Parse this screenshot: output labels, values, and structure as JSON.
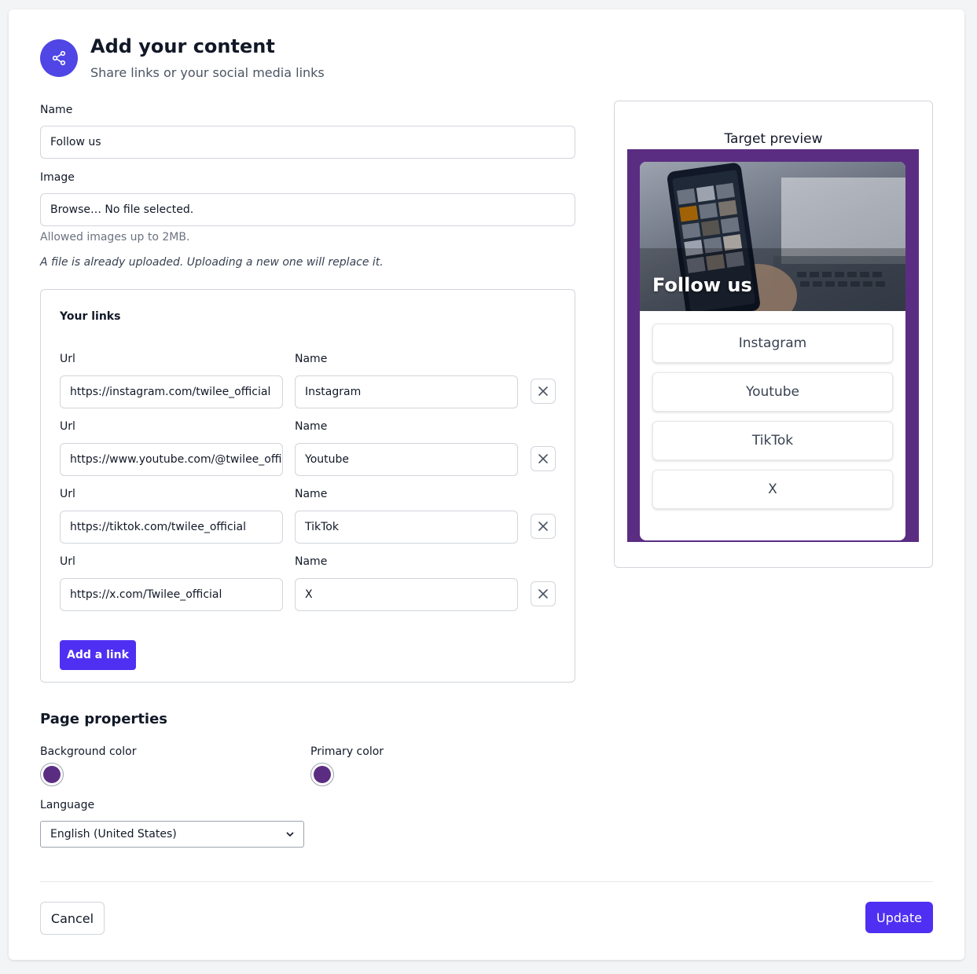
{
  "header": {
    "title": "Add your content",
    "subtitle": "Share links or your social media links",
    "icon": "share-icon"
  },
  "form": {
    "name_label": "Name",
    "name_value": "Follow us",
    "image_label": "Image",
    "image_value": "Browse… No file selected.",
    "image_hint": "Allowed images up to 2MB.",
    "image_notice": "A file is already uploaded. Uploading a new one will replace it."
  },
  "links": {
    "title": "Your links",
    "url_label": "Url",
    "name_label": "Name",
    "items": [
      {
        "url": "https://instagram.com/twilee_official",
        "name": "Instagram"
      },
      {
        "url": "https://www.youtube.com/@twilee_official",
        "name": "Youtube"
      },
      {
        "url": "https://tiktok.com/twilee_official",
        "name": "TikTok"
      },
      {
        "url": "https://x.com/Twilee_official",
        "name": "X"
      }
    ],
    "add_label": "Add a link"
  },
  "page_properties": {
    "title": "Page properties",
    "background_label": "Background color",
    "background_color": "#5b2d82",
    "primary_label": "Primary color",
    "primary_color": "#5b2d82",
    "language_label": "Language",
    "language_value": "English (United States)"
  },
  "actions": {
    "cancel": "Cancel",
    "update": "Update"
  },
  "preview": {
    "title": "Target preview",
    "hero_title": "Follow us",
    "links": [
      "Instagram",
      "Youtube",
      "TikTok",
      "X"
    ]
  },
  "colors": {
    "accent": "#4f2ff2",
    "brand_purple": "#5b2d82"
  }
}
